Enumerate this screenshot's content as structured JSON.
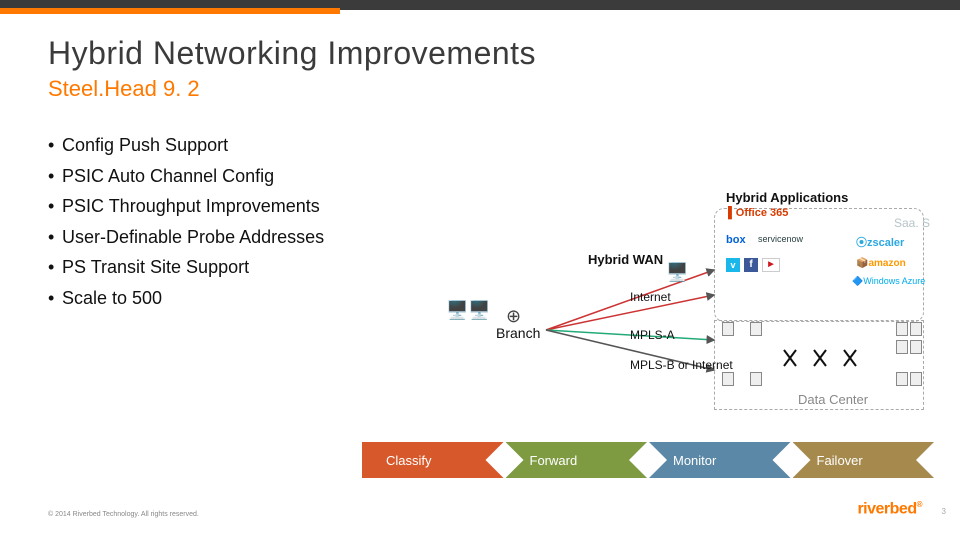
{
  "title": "Hybrid Networking Improvements",
  "subtitle": "Steel.Head 9. 2",
  "bullets": [
    "Config Push Support",
    "PSIC Auto Channel Config",
    "PSIC Throughput Improvements",
    "User-Definable Probe Addresses",
    "PS Transit Site Support",
    "Scale to 500"
  ],
  "diagram": {
    "branch": "Branch",
    "hybrid_wan": "Hybrid WAN",
    "internet": "Internet",
    "mpls_a": "MPLS-A",
    "mpls_b": "MPLS-B or Internet",
    "hybrid_apps": "Hybrid Applications",
    "saas": "Saa. S",
    "data_center": "Data Center"
  },
  "tabs": [
    "Classify",
    "Forward",
    "Monitor",
    "Failover"
  ],
  "footer": "© 2014 Riverbed Technology. All rights reserved.",
  "logo": "riverbed",
  "page": "3"
}
